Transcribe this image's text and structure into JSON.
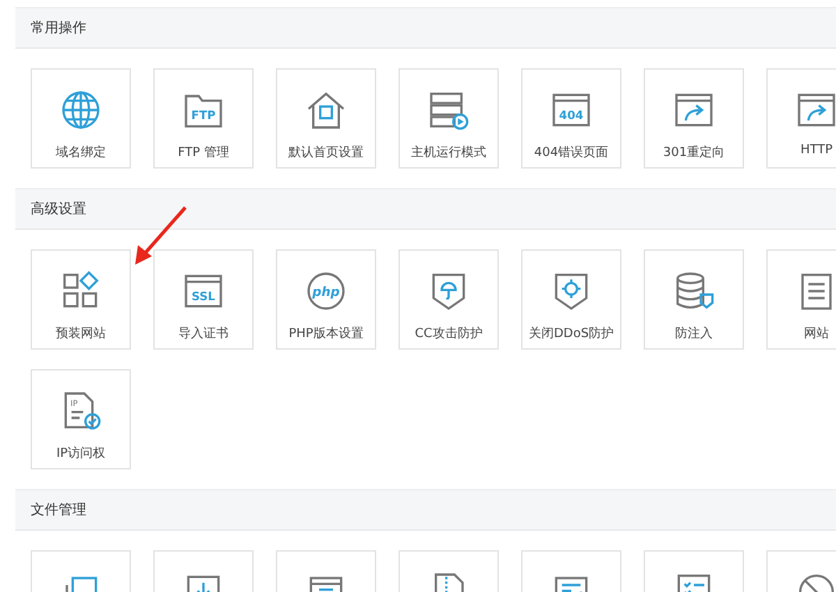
{
  "sections": [
    {
      "title": "常用操作",
      "tiles": [
        {
          "kind": "globe",
          "label": "域名绑定"
        },
        {
          "kind": "ftp",
          "icon_text": "FTP",
          "label": "FTP 管理"
        },
        {
          "kind": "home",
          "label": "默认首页设置"
        },
        {
          "kind": "server",
          "label": "主机运行模式"
        },
        {
          "kind": "page404",
          "icon_text": "404",
          "label": "404错误页面"
        },
        {
          "kind": "redirect",
          "label": "301重定向"
        },
        {
          "kind": "redirect",
          "label": "HTTP"
        }
      ]
    },
    {
      "title": "高级设置",
      "tiles": [
        {
          "kind": "apps",
          "label": "预装网站"
        },
        {
          "kind": "ssl",
          "icon_text": "SSL",
          "label": "导入证书"
        },
        {
          "kind": "php",
          "icon_text": "php",
          "label": "PHP版本设置"
        },
        {
          "kind": "shield",
          "label": "CC攻击防护"
        },
        {
          "kind": "shieldgear",
          "label": "关闭DDoS防护"
        },
        {
          "kind": "database",
          "label": "防注入"
        },
        {
          "kind": "notepad",
          "label": "网站"
        },
        {
          "kind": "ipfile",
          "icon_text": "IP",
          "label": "IP访问权"
        }
      ]
    },
    {
      "title": "文件管理",
      "tiles": [
        {
          "kind": "copy"
        },
        {
          "kind": "download"
        },
        {
          "kind": "zip"
        },
        {
          "kind": "archive"
        },
        {
          "kind": "edit"
        },
        {
          "kind": "list"
        },
        {
          "kind": "ban"
        }
      ]
    }
  ]
}
